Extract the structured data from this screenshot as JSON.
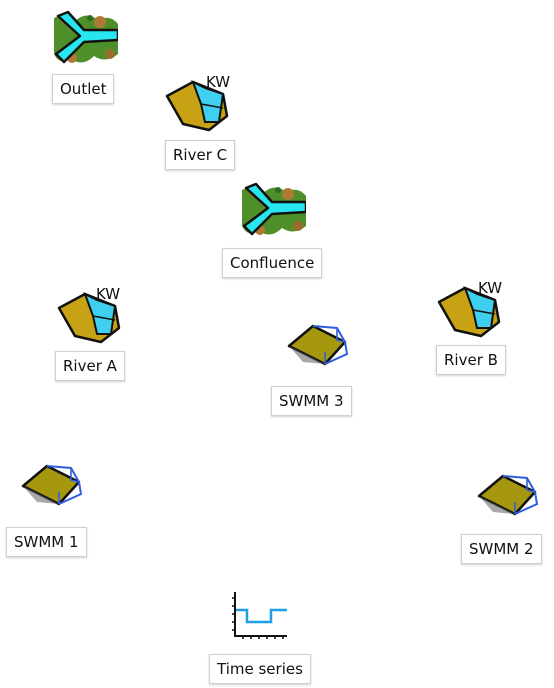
{
  "nodes": {
    "outlet": {
      "label": "Outlet"
    },
    "river_c": {
      "label": "River C",
      "badge": "KW"
    },
    "confluence": {
      "label": "Confluence"
    },
    "river_a": {
      "label": "River A",
      "badge": "KW"
    },
    "river_b": {
      "label": "River B",
      "badge": "KW"
    },
    "swmm3": {
      "label": "SWMM 3"
    },
    "swmm1": {
      "label": "SWMM 1"
    },
    "swmm2": {
      "label": "SWMM 2"
    },
    "time_series": {
      "label": "Time series"
    }
  },
  "colors": {
    "water": "#27e6f0",
    "river_bank": "#c8a215",
    "river_water": "#3fd0ef",
    "terrain_green": "#4e8f2a",
    "terrain_brown": "#9c6c2c",
    "block_face": "#a5980f",
    "block_edge": "#2f5fe0",
    "series_line": "#1e9ee6"
  }
}
